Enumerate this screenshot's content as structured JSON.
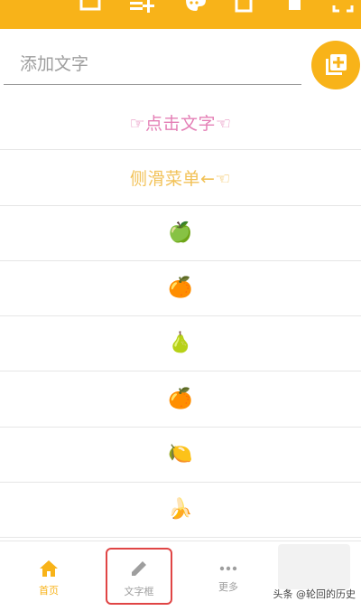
{
  "colors": {
    "accent": "#F8B319",
    "pink_text": "#E47FB6",
    "yellow_text": "#F2C258",
    "active_nav": "#F8B319",
    "inactive_nav": "#9e9e9e",
    "highlight_border": "#e04545"
  },
  "toolbar": {
    "icons": [
      "save-icon",
      "playlist-add-icon",
      "palette-icon",
      "clipboard-icon",
      "file-icon",
      "fullscreen-icon"
    ]
  },
  "input": {
    "placeholder": "添加文字",
    "value": ""
  },
  "fab": {
    "icon": "add-to-library-icon"
  },
  "list": {
    "items": [
      {
        "text": "☞点击文字☜",
        "color": "pink"
      },
      {
        "text": "侧滑菜单←☜",
        "color": "yellow"
      },
      {
        "emoji": "🍏"
      },
      {
        "emoji": "🍊"
      },
      {
        "emoji": "🍐"
      },
      {
        "emoji": "🍊"
      },
      {
        "emoji": "🍋"
      },
      {
        "emoji": "🍌"
      }
    ]
  },
  "nav": {
    "home_label": "首页",
    "text_box_label": "文字框",
    "more_label": "更多"
  },
  "watermark": "头条 @轮回的历史"
}
